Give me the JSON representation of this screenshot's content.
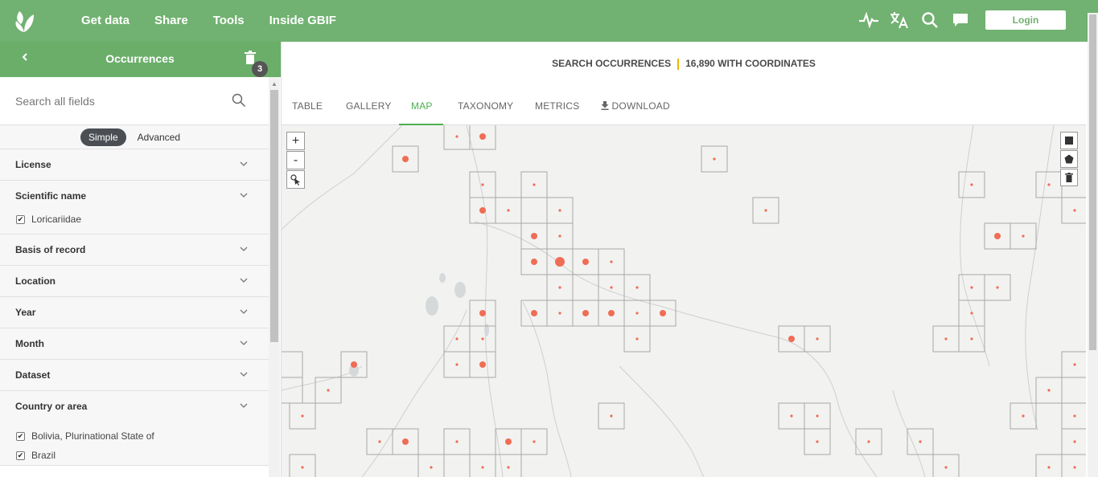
{
  "nav": {
    "logo_icon": "gbif-leaf-icon",
    "items": [
      "Get data",
      "Share",
      "Tools",
      "Inside GBIF"
    ],
    "login_label": "Login",
    "accent": "#71b171"
  },
  "sidebar": {
    "back_icon": "chevron-left-icon",
    "title": "Occurrences",
    "filter_count": "3",
    "search_placeholder": "Search all fields",
    "modes": [
      "Simple",
      "Advanced"
    ],
    "filters": {
      "license": "License",
      "scientific_name": "Scientific name",
      "scientific_name_value": "Loricariidae",
      "basis": "Basis of record",
      "location": "Location",
      "year": "Year",
      "month": "Month",
      "dataset": "Dataset",
      "country": "Country or area",
      "country_values": [
        "Bolivia, Plurinational State of",
        "Brazil"
      ]
    }
  },
  "main": {
    "search_label": "SEARCH OCCURRENCES",
    "count_label": "16,890 WITH COORDINATES",
    "tabs": [
      "TABLE",
      "GALLERY",
      "MAP",
      "TAXONOMY",
      "METRICS",
      "DOWNLOAD"
    ],
    "active_tab": "MAP"
  },
  "map": {
    "zoom_in": "+",
    "zoom_out": "-",
    "draw_tools": [
      "rectangle-icon",
      "polygon-icon",
      "trash-icon"
    ],
    "point_color": "#f06d55"
  }
}
